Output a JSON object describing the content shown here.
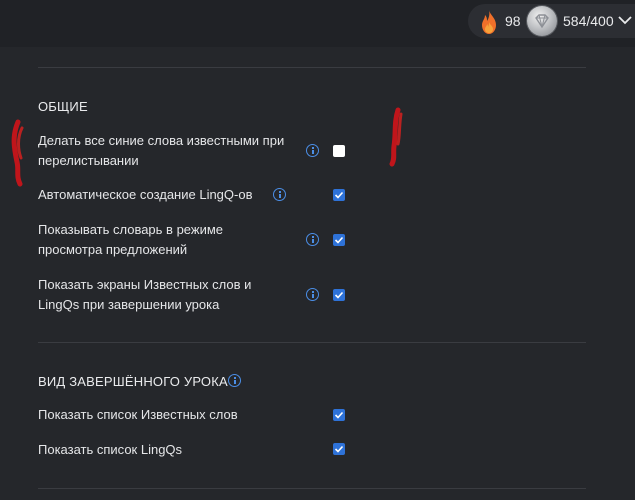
{
  "header": {
    "streak_count": "98",
    "coins": "584/400",
    "icons": {
      "streak": "flame-icon",
      "coins": "coin-icon",
      "menu": "chevron-down-icon"
    }
  },
  "sections": [
    {
      "title": "ОБЩИЕ",
      "rows": [
        {
          "label": "Делать все синие слова известными при перелистывании",
          "checked": false
        },
        {
          "label": "Автоматическое создание LingQ-ов",
          "checked": true
        },
        {
          "label": "Показывать словарь в режиме просмотра предложений",
          "checked": true
        },
        {
          "label": "Показать экраны Известных слов и LingQs при завершении урока",
          "checked": true
        }
      ]
    },
    {
      "title": "ВИД ЗАВЕРШЁННОГО УРОКА",
      "rows": [
        {
          "label": "Показать список Известных слов",
          "checked": true
        },
        {
          "label": "Показать список LingQs",
          "checked": true
        }
      ]
    }
  ],
  "colors": {
    "accent": "#2e72d8",
    "info": "#4b8ee6",
    "background": "#25272b",
    "flame": "#f0702a"
  }
}
